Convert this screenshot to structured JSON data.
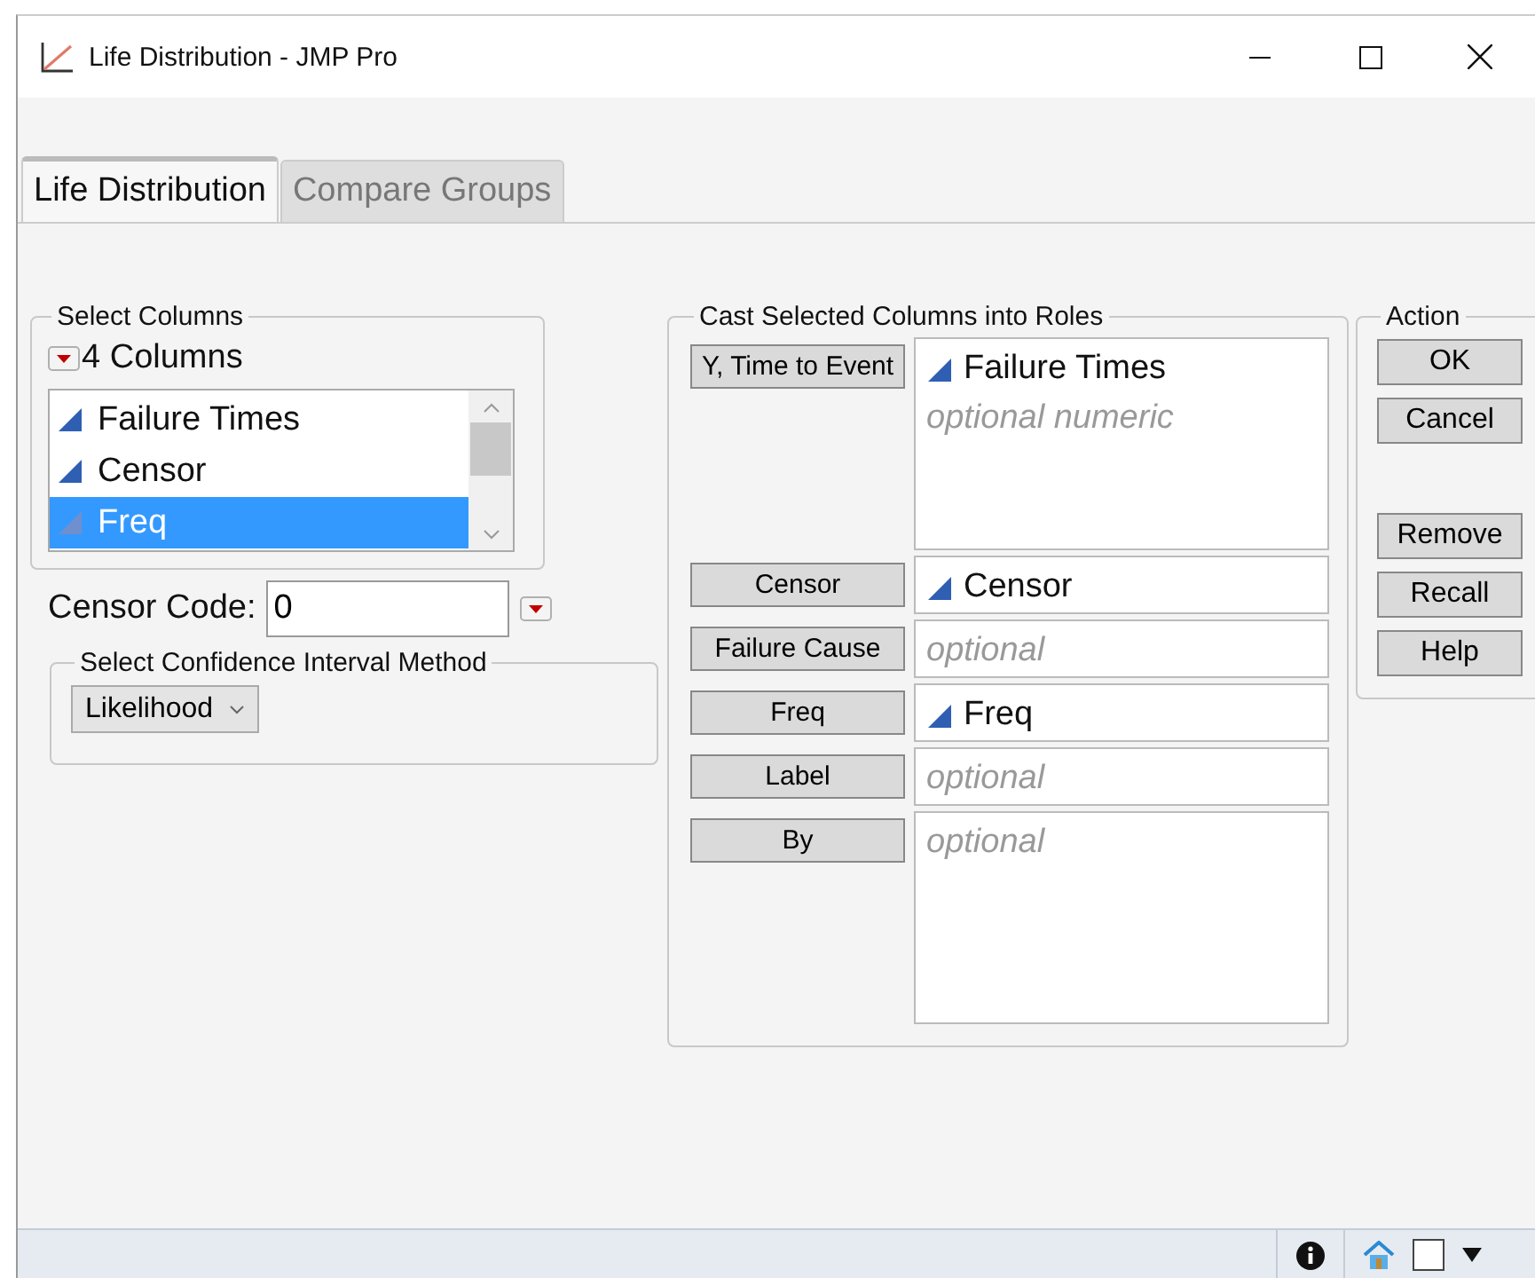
{
  "window": {
    "title": "Life Distribution - JMP Pro"
  },
  "tabs": [
    {
      "label": "Life Distribution",
      "selected": true
    },
    {
      "label": "Compare Groups",
      "selected": false
    }
  ],
  "select_columns": {
    "title": "Select Columns",
    "count": "4 Columns",
    "columns": [
      {
        "name": "Failure Times",
        "selected": false
      },
      {
        "name": "Censor",
        "selected": false
      },
      {
        "name": "Freq",
        "selected": true
      }
    ]
  },
  "censor_code": {
    "label": "Censor Code:",
    "value": "0"
  },
  "ci_method": {
    "title": "Select Confidence Interval Method",
    "value": "Likelihood"
  },
  "roles": {
    "title": "Cast Selected Columns into Roles",
    "rows": [
      {
        "button": "Y, Time to Event",
        "kind": "tall",
        "entries": [
          {
            "kind": "column",
            "text": "Failure Times"
          },
          {
            "kind": "hint",
            "text": "optional numeric"
          }
        ]
      },
      {
        "button": "Censor",
        "kind": "short",
        "entries": [
          {
            "kind": "column",
            "text": "Censor"
          }
        ]
      },
      {
        "button": "Failure Cause",
        "kind": "short",
        "entries": [
          {
            "kind": "hint",
            "text": "optional"
          }
        ]
      },
      {
        "button": "Freq",
        "kind": "short",
        "entries": [
          {
            "kind": "column",
            "text": "Freq"
          }
        ]
      },
      {
        "button": "Label",
        "kind": "short",
        "entries": [
          {
            "kind": "hint",
            "text": "optional"
          }
        ]
      },
      {
        "button": "By",
        "kind": "tall",
        "entries": [
          {
            "kind": "hint",
            "text": "optional"
          }
        ]
      }
    ]
  },
  "actions": {
    "title": "Action",
    "groups": [
      {
        "buttons": [
          "OK",
          "Cancel"
        ]
      },
      {
        "buttons": [
          "Remove",
          "Recall",
          "Help"
        ]
      }
    ]
  }
}
